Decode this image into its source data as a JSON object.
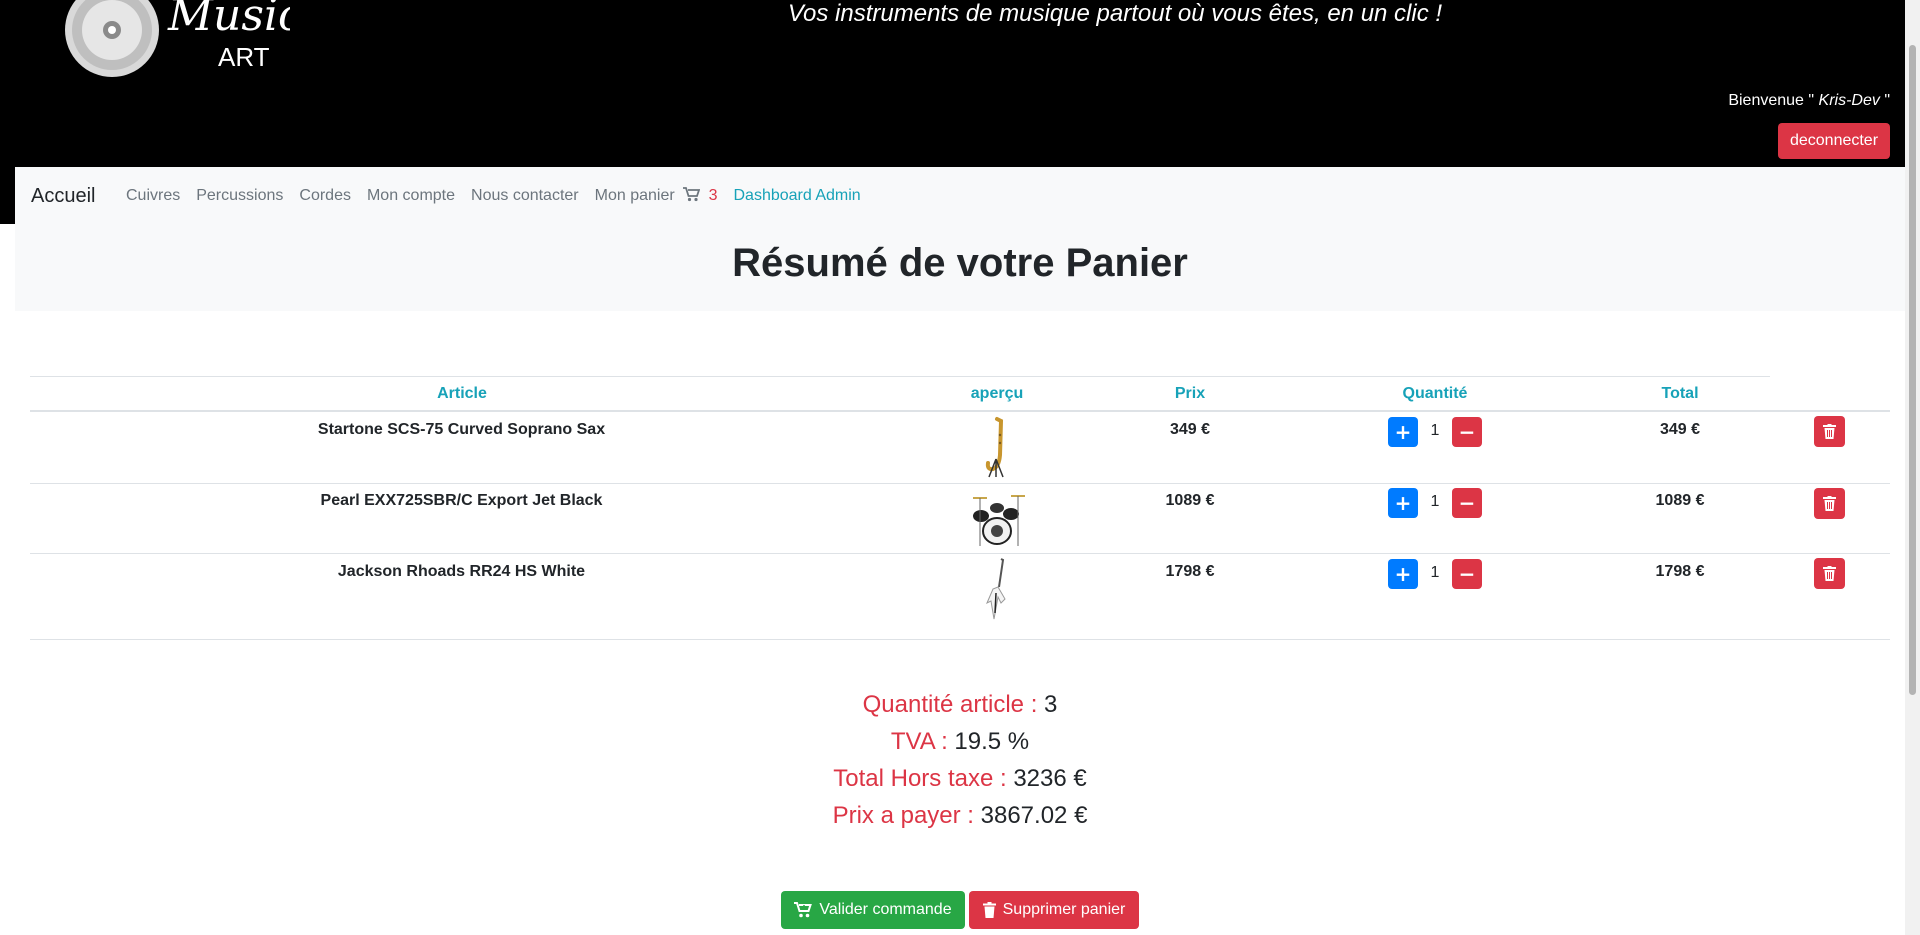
{
  "header": {
    "tagline": "Vos instruments de musique partout où vous êtes, en un clic !",
    "logo_text_top": "Music",
    "logo_text_bottom": "ART",
    "welcome_prefix": "Bienvenue \"",
    "username": "Kris-Dev",
    "welcome_suffix": "\"",
    "logout_label": "deconnecter"
  },
  "nav": {
    "brand": "Accueil",
    "links": [
      "Cuivres",
      "Percussions",
      "Cordes",
      "Mon compte",
      "Nous contacter"
    ],
    "cart_label": "Mon panier",
    "cart_count": "3",
    "admin_label": "Dashboard Admin"
  },
  "page_title": "Résumé de votre Panier",
  "table": {
    "headers": {
      "article": "Article",
      "apercu": "aperçu",
      "prix": "Prix",
      "quantite": "Quantité",
      "total": "Total"
    },
    "rows": [
      {
        "name": "Startone SCS-75 Curved Soprano Sax",
        "price": "349 €",
        "qty": "1",
        "total": "349 €",
        "thumb": "saxophone-icon"
      },
      {
        "name": "Pearl EXX725SBR/C Export Jet Black",
        "price": "1089 €",
        "qty": "1",
        "total": "1089 €",
        "thumb": "drum-kit-icon"
      },
      {
        "name": "Jackson Rhoads RR24 HS White",
        "price": "1798 €",
        "qty": "1",
        "total": "1798 €",
        "thumb": "guitar-icon"
      }
    ],
    "plus_symbol": "+",
    "minus_symbol": "−"
  },
  "summary": {
    "qty_label": "Quantité article :",
    "qty_value": "3",
    "tva_label": "TVA :",
    "tva_value": "19.5 %",
    "ht_label": "Total Hors taxe :",
    "ht_value": "3236 €",
    "pay_label": "Prix a payer :",
    "pay_value": "3867.02 €"
  },
  "actions": {
    "validate_label": "Valider commande",
    "clear_label": "Supprimer panier"
  },
  "colors": {
    "header_bg": "#000000",
    "danger": "#dc3545",
    "primary": "#007bff",
    "success": "#28a745",
    "info": "#17a2b8",
    "nav_bg": "#f8f9fa"
  }
}
